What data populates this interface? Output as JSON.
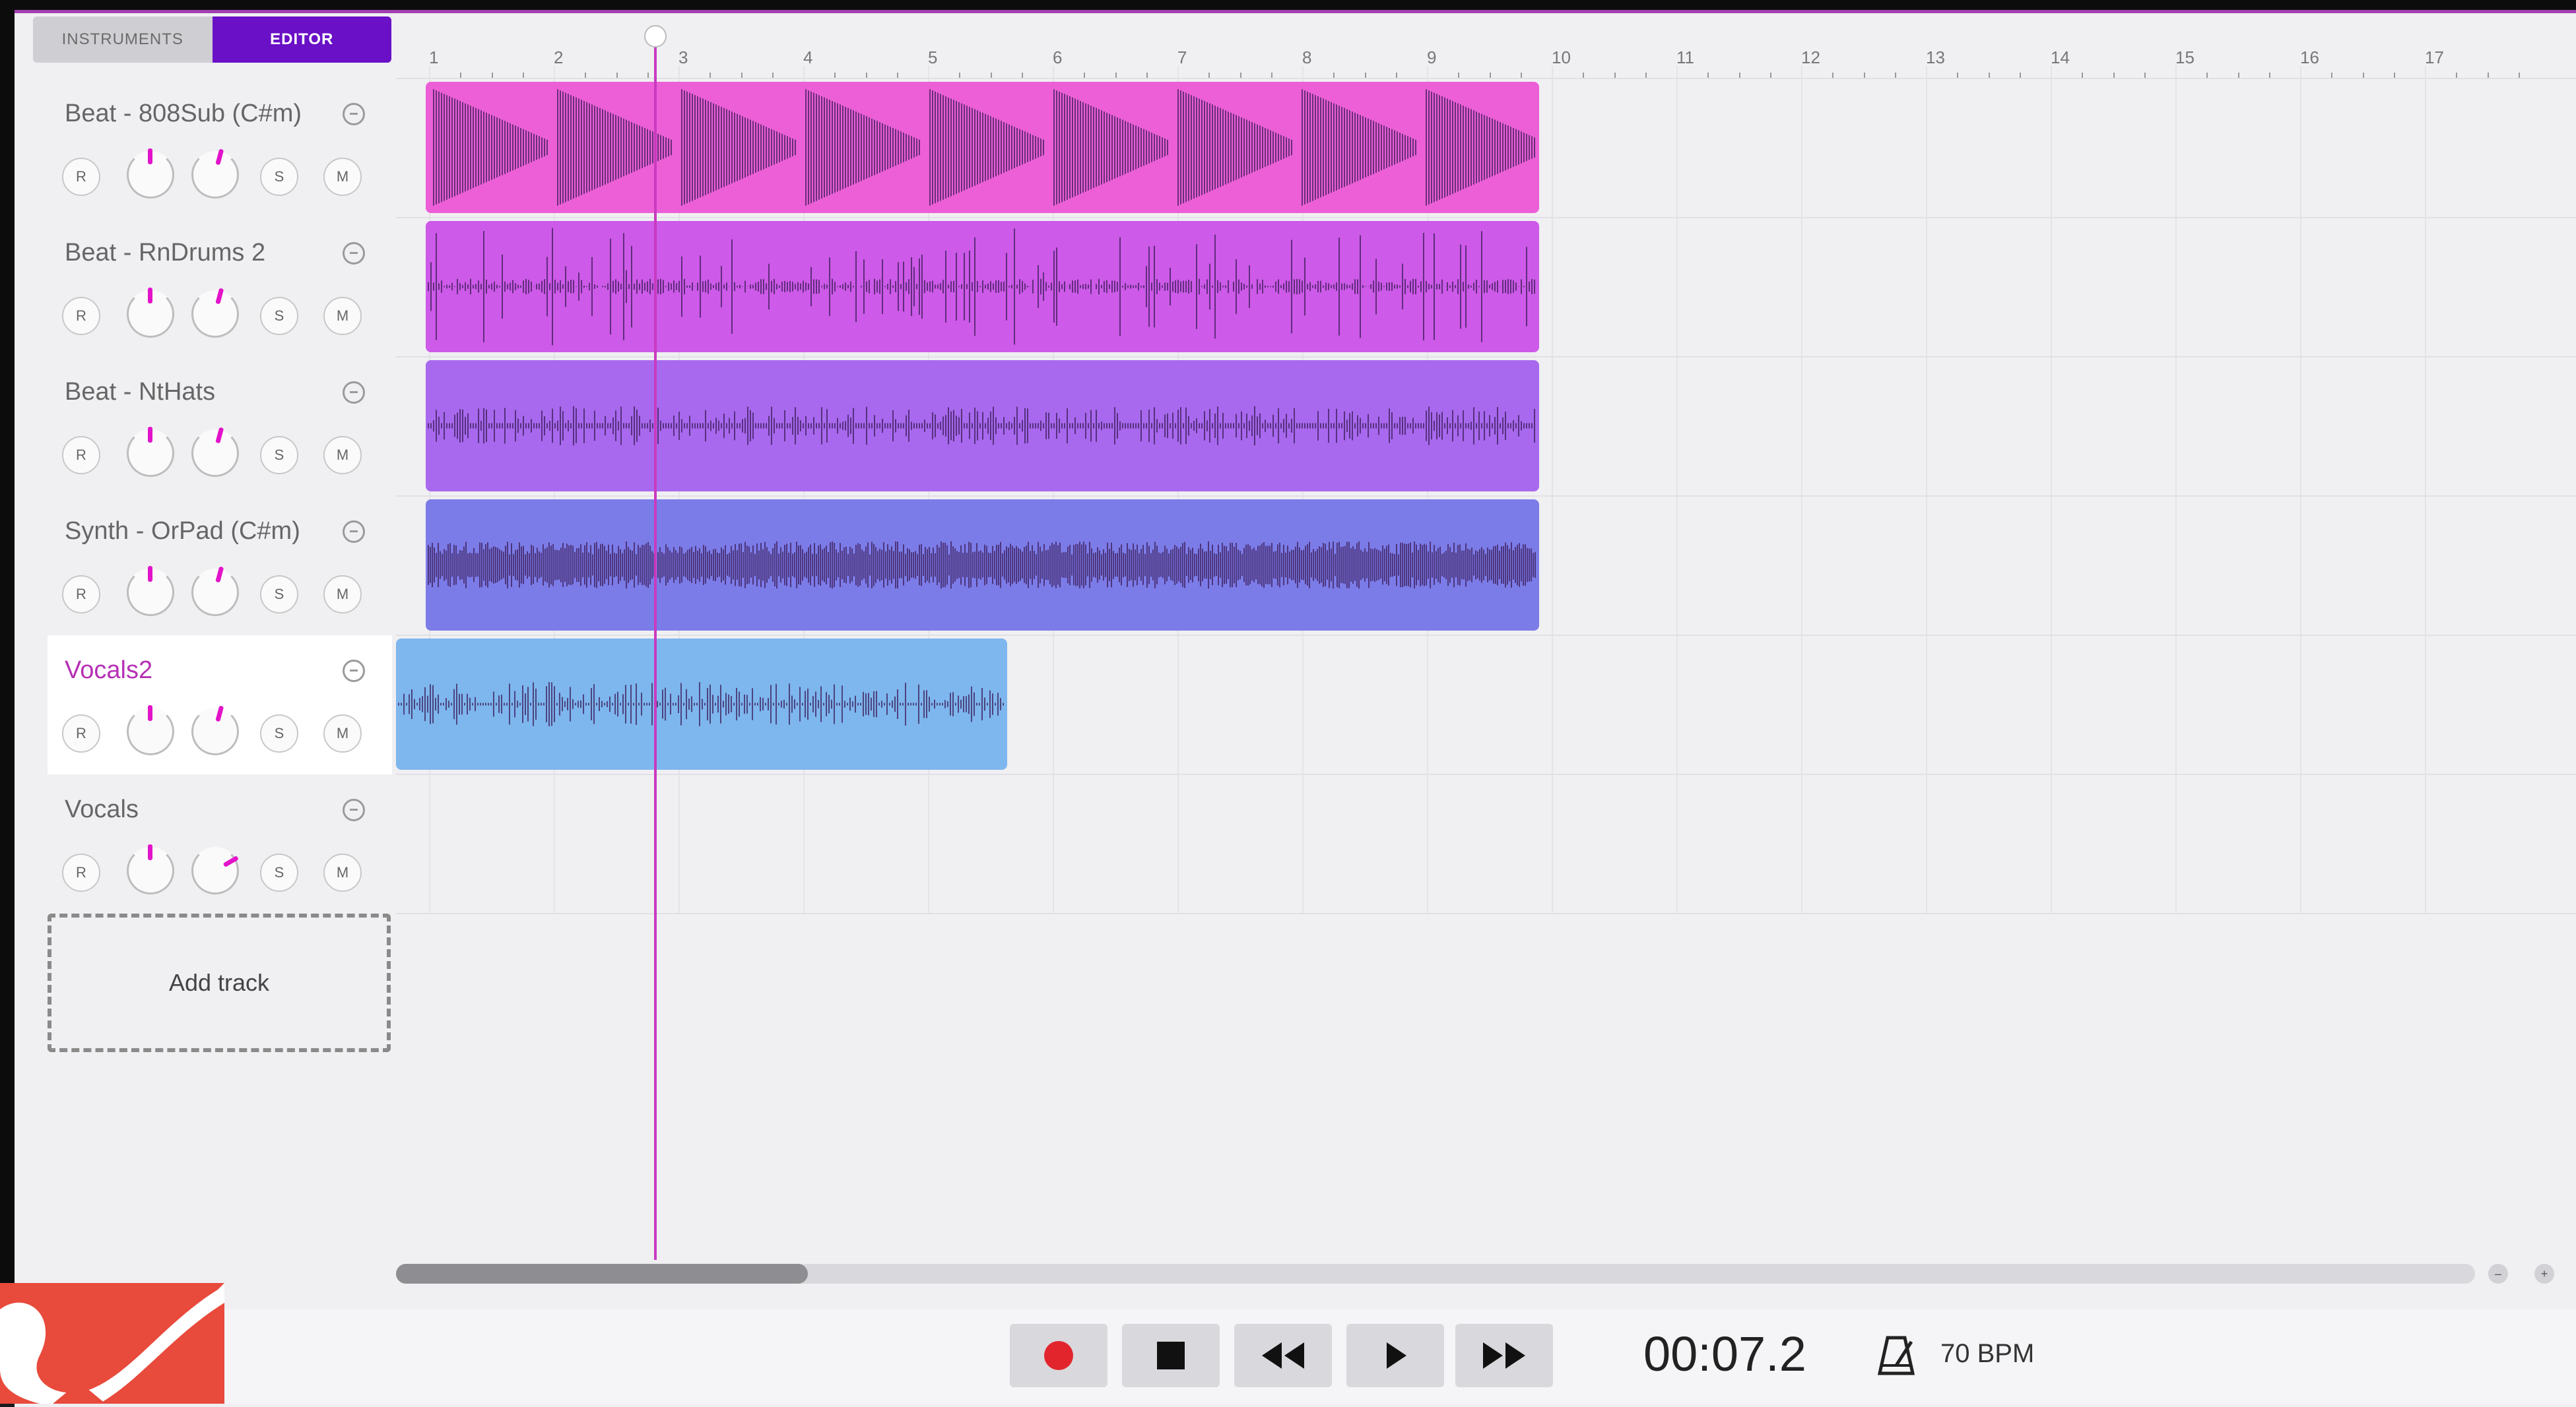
{
  "mode_tabs": {
    "instruments": "INSTRUMENTS",
    "editor": "EDITOR"
  },
  "tracks": [
    {
      "name": "Beat - 808Sub (C#m)",
      "record": "R",
      "solo": "S",
      "mute": "M",
      "color": "#ec5fd7"
    },
    {
      "name": "Beat - RnDrums 2",
      "record": "R",
      "solo": "S",
      "mute": "M",
      "color": "#cd5ae8"
    },
    {
      "name": "Beat - NtHats",
      "record": "R",
      "solo": "S",
      "mute": "M",
      "color": "#a869ee"
    },
    {
      "name": "Synth - OrPad (C#m)",
      "record": "R",
      "solo": "S",
      "mute": "M",
      "color": "#7c7ce8"
    },
    {
      "name": "Vocals2",
      "record": "R",
      "solo": "S",
      "mute": "M",
      "color": "#7eb6ee",
      "active": true
    },
    {
      "name": "Vocals",
      "record": "R",
      "solo": "S",
      "mute": "M",
      "color": ""
    }
  ],
  "add_track_label": "Add track",
  "ruler": [
    "1",
    "2",
    "3",
    "4",
    "5",
    "6",
    "7",
    "8",
    "9",
    "10",
    "11",
    "12",
    "13",
    "14",
    "15",
    "16",
    "17"
  ],
  "transport": {
    "time": "00:07.2",
    "bpm": "70 BPM",
    "icons": [
      "record-icon",
      "stop-icon",
      "rewind-icon",
      "play-icon",
      "fast-forward-icon",
      "metronome-icon"
    ]
  },
  "colors": {
    "accent": "#6a10c6",
    "playhead": "#c93ac0",
    "record": "#e2252c",
    "logo": "#e84a3c"
  }
}
